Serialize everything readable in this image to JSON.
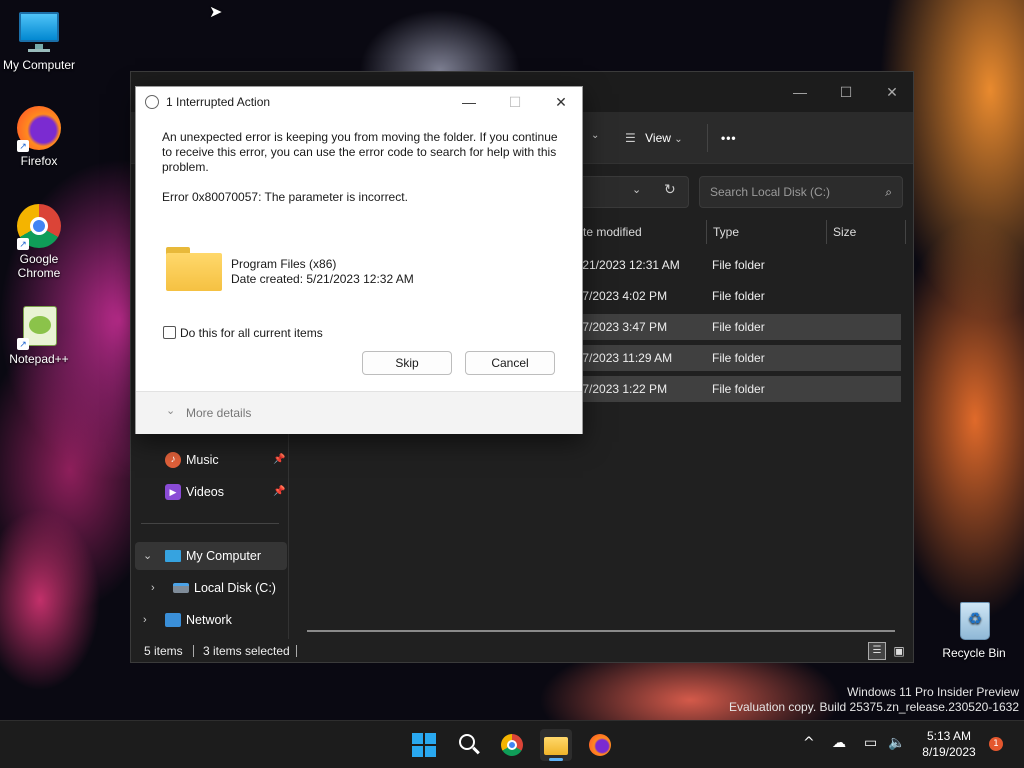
{
  "desktop": {
    "icons": [
      {
        "label": "My Computer"
      },
      {
        "label": "Firefox"
      },
      {
        "label": "Google Chrome"
      },
      {
        "label": "Notepad++"
      },
      {
        "label": "Recycle Bin"
      }
    ],
    "watermark": {
      "line1": "Windows 11 Pro Insider Preview",
      "line2": "Evaluation copy. Build 25375.zn_release.230520-1632"
    }
  },
  "explorer": {
    "toolbar": {
      "view_label": "View",
      "more_label": "•••"
    },
    "search": {
      "placeholder": "Search Local Disk (C:)"
    },
    "columns": [
      "te modified",
      "Type",
      "Size"
    ],
    "rows": [
      {
        "date": "/21/2023 12:31 AM",
        "type": "File folder"
      },
      {
        "date": "/7/2023 4:02 PM",
        "type": "File folder"
      },
      {
        "date": "/7/2023 3:47 PM",
        "type": "File folder"
      },
      {
        "date": "/7/2023 11:29 AM",
        "type": "File folder"
      },
      {
        "date": "/7/2023 1:22 PM",
        "type": "File folder"
      }
    ],
    "nav": {
      "music": "Music",
      "videos": "Videos",
      "my_computer": "My Computer",
      "local_disk": "Local Disk (C:)",
      "network": "Network"
    },
    "status": {
      "items": "5 items",
      "selected": "3 items selected"
    }
  },
  "dialog": {
    "title": "1 Interrupted Action",
    "message": "An unexpected error is keeping you from moving the folder. If you continue to receive this error, you can use the error code to search for help with this problem.",
    "error": "Error 0x80070057: The parameter is incorrect.",
    "item_name": "Program Files (x86)",
    "item_date": "Date created: 5/21/2023 12:32 AM",
    "checkbox_label": "Do this for all current items",
    "skip_label": "Skip",
    "cancel_label": "Cancel",
    "more_details": "More details"
  },
  "taskbar": {
    "time": "5:13 AM",
    "date": "8/19/2023",
    "notification_count": "1"
  }
}
